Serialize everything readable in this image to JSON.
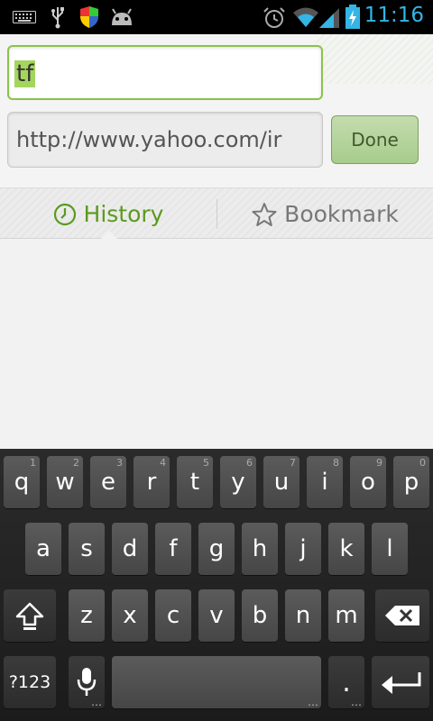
{
  "status_bar": {
    "time": "11:16",
    "icons": [
      "keyboard-icon",
      "usb-icon",
      "shield-icon",
      "android-icon",
      "alarm-icon",
      "wifi-icon",
      "signal-icon",
      "battery-charging-icon"
    ]
  },
  "editor": {
    "title_value": "tf",
    "url_value": "http://www.yahoo.com/ir",
    "done_label": "Done"
  },
  "tabs": {
    "history_label": "History",
    "bookmark_label": "Bookmark"
  },
  "colors": {
    "accent_green": "#5b9a1e",
    "clock_blue": "#33b5e5",
    "selection_green": "#a4d65e"
  },
  "keyboard": {
    "row1": [
      {
        "key": "q",
        "hint": "1"
      },
      {
        "key": "w",
        "hint": "2"
      },
      {
        "key": "e",
        "hint": "3"
      },
      {
        "key": "r",
        "hint": "4"
      },
      {
        "key": "t",
        "hint": "5"
      },
      {
        "key": "y",
        "hint": "6"
      },
      {
        "key": "u",
        "hint": "7"
      },
      {
        "key": "i",
        "hint": "8"
      },
      {
        "key": "o",
        "hint": "9"
      },
      {
        "key": "p",
        "hint": "0"
      }
    ],
    "row2": [
      "a",
      "s",
      "d",
      "f",
      "g",
      "h",
      "j",
      "k",
      "l"
    ],
    "row3": [
      "z",
      "x",
      "c",
      "v",
      "b",
      "n",
      "m"
    ],
    "symbols_label": "?123",
    "period_label": ".",
    "ellipsis": "…"
  }
}
